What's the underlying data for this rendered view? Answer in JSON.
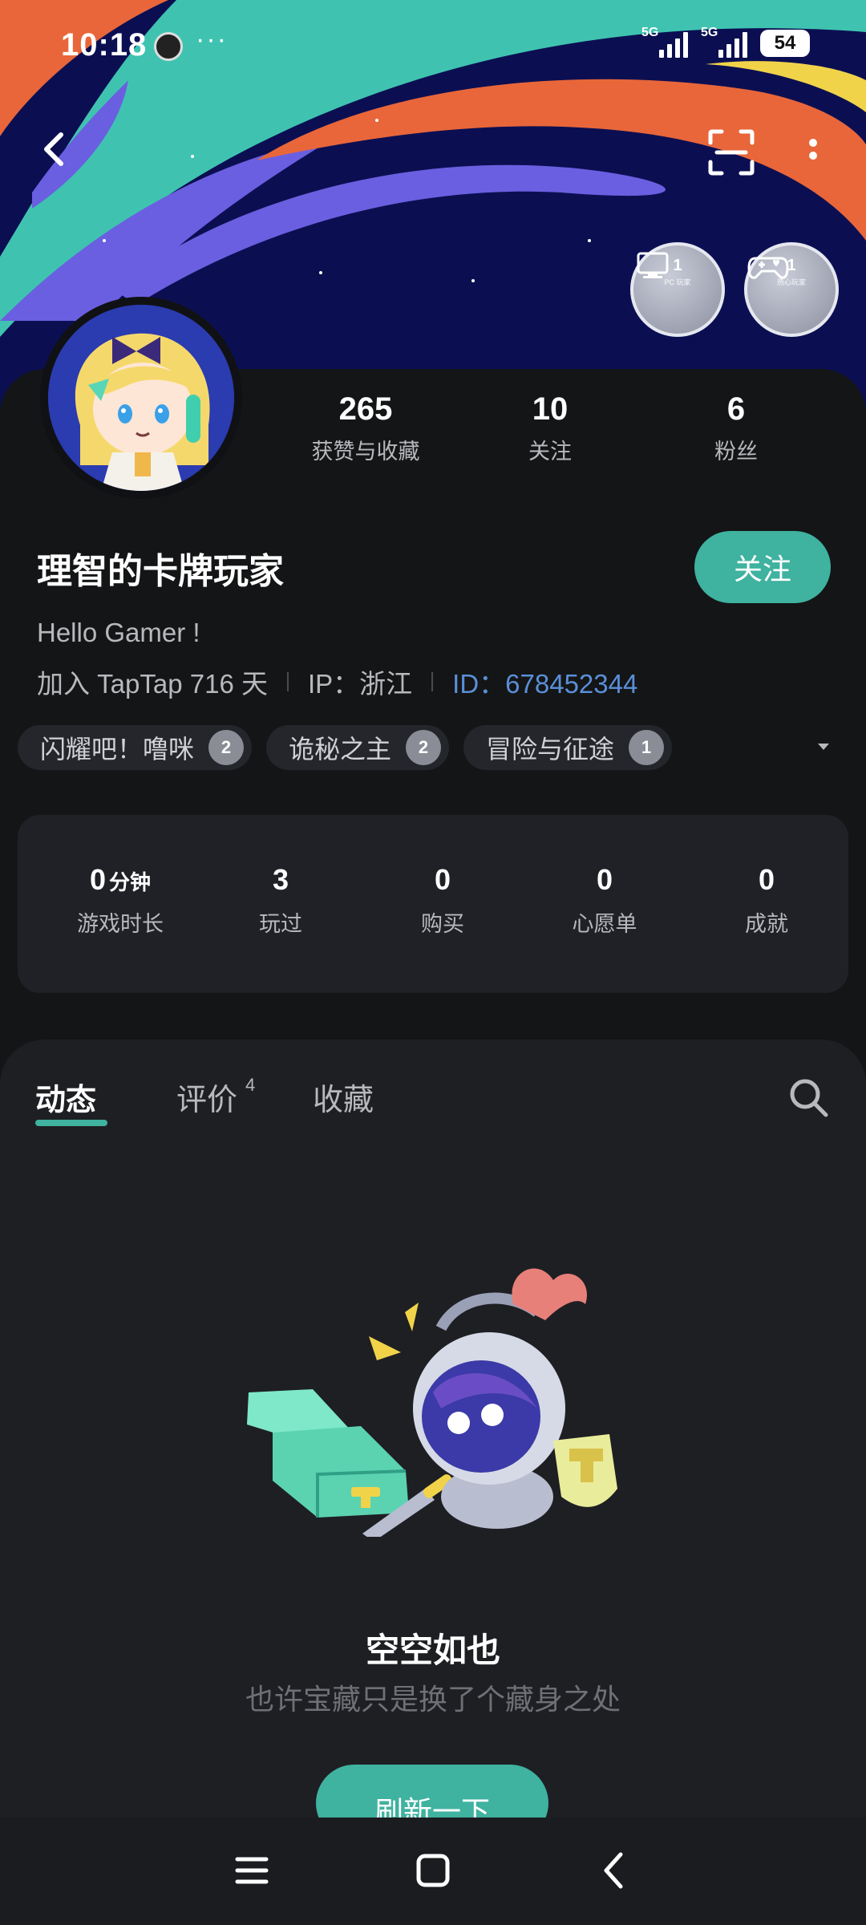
{
  "status_bar": {
    "time": "10:18",
    "more": "···",
    "signal_1": "5G",
    "signal_2": "5G",
    "battery": "54"
  },
  "header": {
    "back_icon": "chevron-left-icon",
    "scan_icon": "scan-icon",
    "menu_icon": "more-vertical-icon",
    "badges": [
      {
        "count": "1",
        "label": "PC 玩家",
        "icon": "monitor-icon"
      },
      {
        "count": "1",
        "label": "热心玩家",
        "icon": "gamepad-heart-icon"
      }
    ]
  },
  "profile": {
    "stats": [
      {
        "value": "265",
        "label": "获赞与收藏"
      },
      {
        "value": "10",
        "label": "关注"
      },
      {
        "value": "6",
        "label": "粉丝"
      }
    ],
    "username": "理智的卡牌玩家",
    "follow_label": "关注",
    "bio": "Hello Gamer !",
    "joined": "加入 TapTap 716 天",
    "ip": "IP：浙江",
    "id_label": "ID：",
    "id_value": "678452344",
    "games": [
      {
        "name": "闪耀吧！噜咪",
        "level": "2"
      },
      {
        "name": "诡秘之主",
        "level": "2"
      },
      {
        "name": "冒险与征途",
        "level": "1"
      }
    ]
  },
  "game_stats": [
    {
      "value": "0",
      "unit": "分钟",
      "label": "游戏时长"
    },
    {
      "value": "3",
      "unit": "",
      "label": "玩过"
    },
    {
      "value": "0",
      "unit": "",
      "label": "购买"
    },
    {
      "value": "0",
      "unit": "",
      "label": "心愿单"
    },
    {
      "value": "0",
      "unit": "",
      "label": "成就"
    }
  ],
  "tabs": [
    {
      "label": "动态",
      "count": ""
    },
    {
      "label": "评价",
      "count": "4"
    },
    {
      "label": "收藏",
      "count": ""
    }
  ],
  "empty_state": {
    "title": "空空如也",
    "subtitle": "也许宝藏只是换了个藏身之处",
    "button": "刷新一下"
  },
  "colors": {
    "accent": "#3fb2a0",
    "id_link": "#5a8fd8",
    "background": "#1b1c20"
  }
}
